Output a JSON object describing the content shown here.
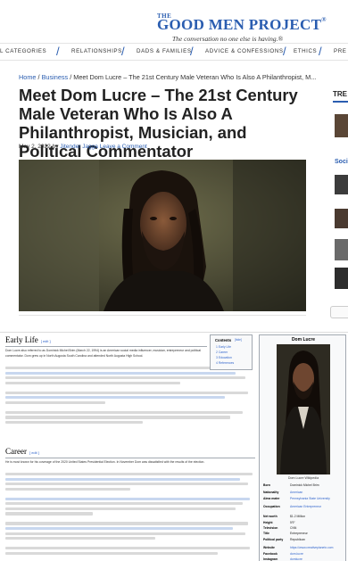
{
  "site": {
    "logo_the": "THE",
    "logo_main": "GOOD MEN PROJECT",
    "logo_reg": "®",
    "tagline": "The conversation no one else is having.®"
  },
  "nav": {
    "items": [
      {
        "label": "L CATEGORIES"
      },
      {
        "label": "RELATIONSHIPS"
      },
      {
        "label": "DADS & FAMILIES"
      },
      {
        "label": "ADVICE & CONFESSIONS"
      },
      {
        "label": "ETHICS"
      },
      {
        "label": "PRE"
      }
    ]
  },
  "breadcrumb": {
    "home": "Home",
    "sep": " / ",
    "section": "Business",
    "current": "Meet Dom Lucre – The 21st Century Male Veteran Who Is Also A Philanthropist, M..."
  },
  "article": {
    "title": "Meet Dom Lucre – The 21st Century Male Veteran Who Is Also A Philanthropist, Musician, and Political Commentator",
    "date": "May 2, 2022",
    "by": " by ",
    "author": "Jitender Jagga",
    "comment": "Leave a Comment"
  },
  "sidebar": {
    "trending_label": "TRE",
    "social_label": "Soci"
  },
  "wiki": {
    "early_life": "Early Life",
    "early_text": "Dom Lucre also referred to as Dominick Michel Brim (March 22, 1994) is an American social media influencer, musician, entrepreneur and political commentator. Dom grew up in North Augusta South Carolina and attended North Augusta High School.",
    "career": "Career",
    "career_text": "He is most known for his coverage of the 2020 United States Presidential Election. In November Dom was dissatisfied with the results of the election.",
    "edit": "[ edit ]",
    "toc": {
      "title": "Contents",
      "hide": "[hide]",
      "items": [
        "1  Early Life",
        "2  Career",
        "3  Education",
        "4  References"
      ]
    },
    "infobox": {
      "name": "Dom Lucre",
      "caption": "Dom Lucre Wikipedia",
      "rows": [
        {
          "k": "Born",
          "v": "Dominick Michel Brim"
        },
        {
          "k": "Nationality",
          "v": "American"
        },
        {
          "k": "Alma mater",
          "v": "Pennsylvania State University"
        },
        {
          "k": "Occupation",
          "v": "American Entrepreneur"
        },
        {
          "k": "Net worth",
          "v": "$1.2 Million"
        },
        {
          "k": "Height",
          "v": "5'9\""
        },
        {
          "k": "Television",
          "v": "CNN"
        },
        {
          "k": "Title",
          "v": "Entrepreneur"
        },
        {
          "k": "Political party",
          "v": "Republican"
        },
        {
          "k": "Website",
          "v": "https://www.creativeplanetx.com"
        },
        {
          "k": "Facebook",
          "v": "dom.lucre"
        },
        {
          "k": "Instagram",
          "v": "domlucre"
        }
      ]
    }
  },
  "colors": {
    "accent": "#2a5db0",
    "link": "#3366cc"
  }
}
